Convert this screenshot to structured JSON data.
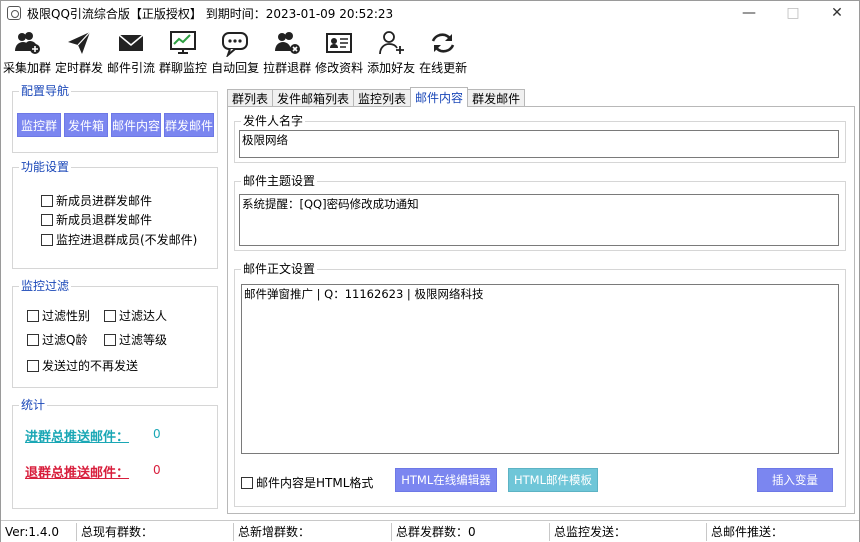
{
  "window": {
    "title": "极限QQ引流综合版【正版授权】 到期时间：2023-01-09 20:52:23",
    "controls": {
      "minimize": "—",
      "maximize": "□",
      "close": "✕"
    }
  },
  "toolbar": [
    {
      "label": "采集加群",
      "icon": "users-add-icon"
    },
    {
      "label": "定时群发",
      "icon": "paper-plane-icon"
    },
    {
      "label": "邮件引流",
      "icon": "envelope-icon"
    },
    {
      "label": "群聊监控",
      "icon": "monitor-chart-icon"
    },
    {
      "label": "自动回复",
      "icon": "chat-bubble-icon"
    },
    {
      "label": "拉群退群",
      "icon": "users-remove-icon"
    },
    {
      "label": "修改资料",
      "icon": "id-card-icon"
    },
    {
      "label": "添加好友",
      "icon": "user-add-icon"
    },
    {
      "label": "在线更新",
      "icon": "refresh-icon"
    }
  ],
  "nav": {
    "title": "配置导航",
    "buttons": [
      "监控群",
      "发件箱",
      "邮件内容",
      "群发邮件"
    ]
  },
  "features": {
    "title": "功能设置",
    "options": [
      "新成员进群发邮件",
      "新成员退群发邮件",
      "监控进退群成员(不发邮件)"
    ]
  },
  "filter": {
    "title": "监控过滤",
    "options": [
      "过滤性别",
      "过滤达人",
      "过滤Q龄",
      "过滤等级",
      "发送过的不再发送"
    ]
  },
  "stats": {
    "title": "统计",
    "join_label": "进群总推送邮件：",
    "join_value": "0",
    "leave_label": "退群总推送邮件：",
    "leave_value": "0",
    "colors": {
      "join": "#1aa7b5",
      "leave": "#d81e3c"
    }
  },
  "tabs": [
    "群列表",
    "发件邮箱列表",
    "监控列表",
    "邮件内容",
    "群发邮件"
  ],
  "active_tab": "邮件内容",
  "content": {
    "sender_title": "发件人名字",
    "sender_value": "极限网络",
    "subject_title": "邮件主题设置",
    "subject_value": "系统提醒：[QQ]密码修改成功通知",
    "body_title": "邮件正文设置",
    "body_value": "邮件弹窗推广 | Q：11162623 | 极限网络科技",
    "html_checkbox": "邮件内容是HTML格式",
    "btn_editor": "HTML在线编辑器",
    "btn_template": "HTML邮件模板",
    "btn_insert": "插入变量"
  },
  "statusbar": {
    "version": "Ver:1.4.0",
    "total_groups": "总现有群数：",
    "new_groups": "总新增群数：",
    "sent_groups": "总群发群数：0",
    "monitor_sent": "总监控发送：",
    "mail_pushed": "总邮件推送："
  },
  "colors": {
    "accent": "#7b86f0",
    "teal": "#6fc6d8",
    "group_title": "#1a47b8"
  }
}
